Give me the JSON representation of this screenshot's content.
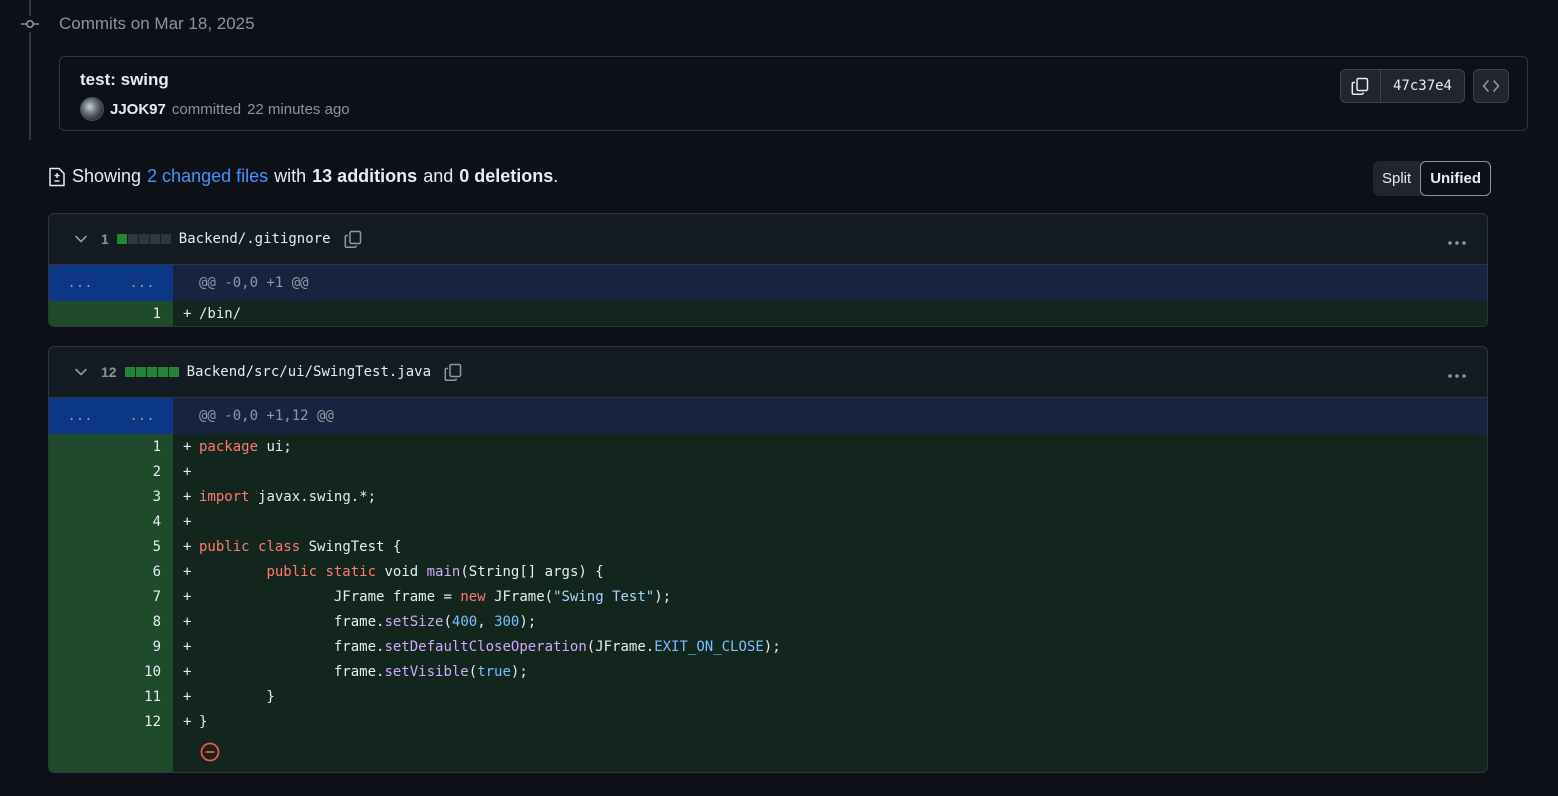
{
  "timeline": {
    "heading": "Commits on Mar 18, 2025"
  },
  "commit": {
    "title": "test: swing",
    "author": "JJOK97",
    "action": "committed",
    "time": "22 minutes ago",
    "sha": "47c37e4"
  },
  "summary": {
    "showing": "Showing",
    "changed_files": "2 changed files",
    "with": "with",
    "additions": "13 additions",
    "and": "and",
    "deletions": "0 deletions",
    "period": "."
  },
  "view_toggle": {
    "split": "Split",
    "unified": "Unified",
    "selected": "Unified"
  },
  "files": [
    {
      "count": "1",
      "name": "Backend/.gitignore",
      "hunk": "@@ -0,0 +1 @@",
      "hunk_left": "...",
      "hunk_right": "...",
      "lines": [
        {
          "n": "1",
          "sign": "+",
          "text": "/bin/"
        }
      ]
    },
    {
      "count": "12",
      "name": "Backend/src/ui/SwingTest.java",
      "hunk": "@@ -0,0 +1,12 @@",
      "hunk_left": "...",
      "hunk_right": "...",
      "lines": [
        {
          "n": "1",
          "sign": "+",
          "text": "package ui;"
        },
        {
          "n": "2",
          "sign": "+",
          "text": ""
        },
        {
          "n": "3",
          "sign": "+",
          "text": "import javax.swing.*;"
        },
        {
          "n": "4",
          "sign": "+",
          "text": ""
        },
        {
          "n": "5",
          "sign": "+",
          "text": "public class SwingTest {"
        },
        {
          "n": "6",
          "sign": "+",
          "text": "        public static void main(String[] args) {"
        },
        {
          "n": "7",
          "sign": "+",
          "text": "                JFrame frame = new JFrame(\"Swing Test\");"
        },
        {
          "n": "8",
          "sign": "+",
          "text": "                frame.setSize(400, 300);"
        },
        {
          "n": "9",
          "sign": "+",
          "text": "                frame.setDefaultCloseOperation(JFrame.EXIT_ON_CLOSE);"
        },
        {
          "n": "10",
          "sign": "+",
          "text": "                frame.setVisible(true);"
        },
        {
          "n": "11",
          "sign": "+",
          "text": "        }"
        },
        {
          "n": "12",
          "sign": "+",
          "text": "}"
        }
      ]
    }
  ],
  "colors": {
    "accent_link": "#4493f8",
    "addition_block": "#238636",
    "keyword": "#ff7b72",
    "function": "#d2a8ff",
    "string": "#a5d6ff",
    "constant": "#79c0ff",
    "no_newline_icon": "#f85149"
  },
  "icons": {
    "timeline": "git-commit-icon",
    "copy": "copy-icon",
    "browse": "code-icon",
    "file_diff": "file-diff-icon",
    "chevron": "chevron-down-icon",
    "menu": "kebab-horizontal-icon",
    "no_newline": "no-entry-icon"
  }
}
